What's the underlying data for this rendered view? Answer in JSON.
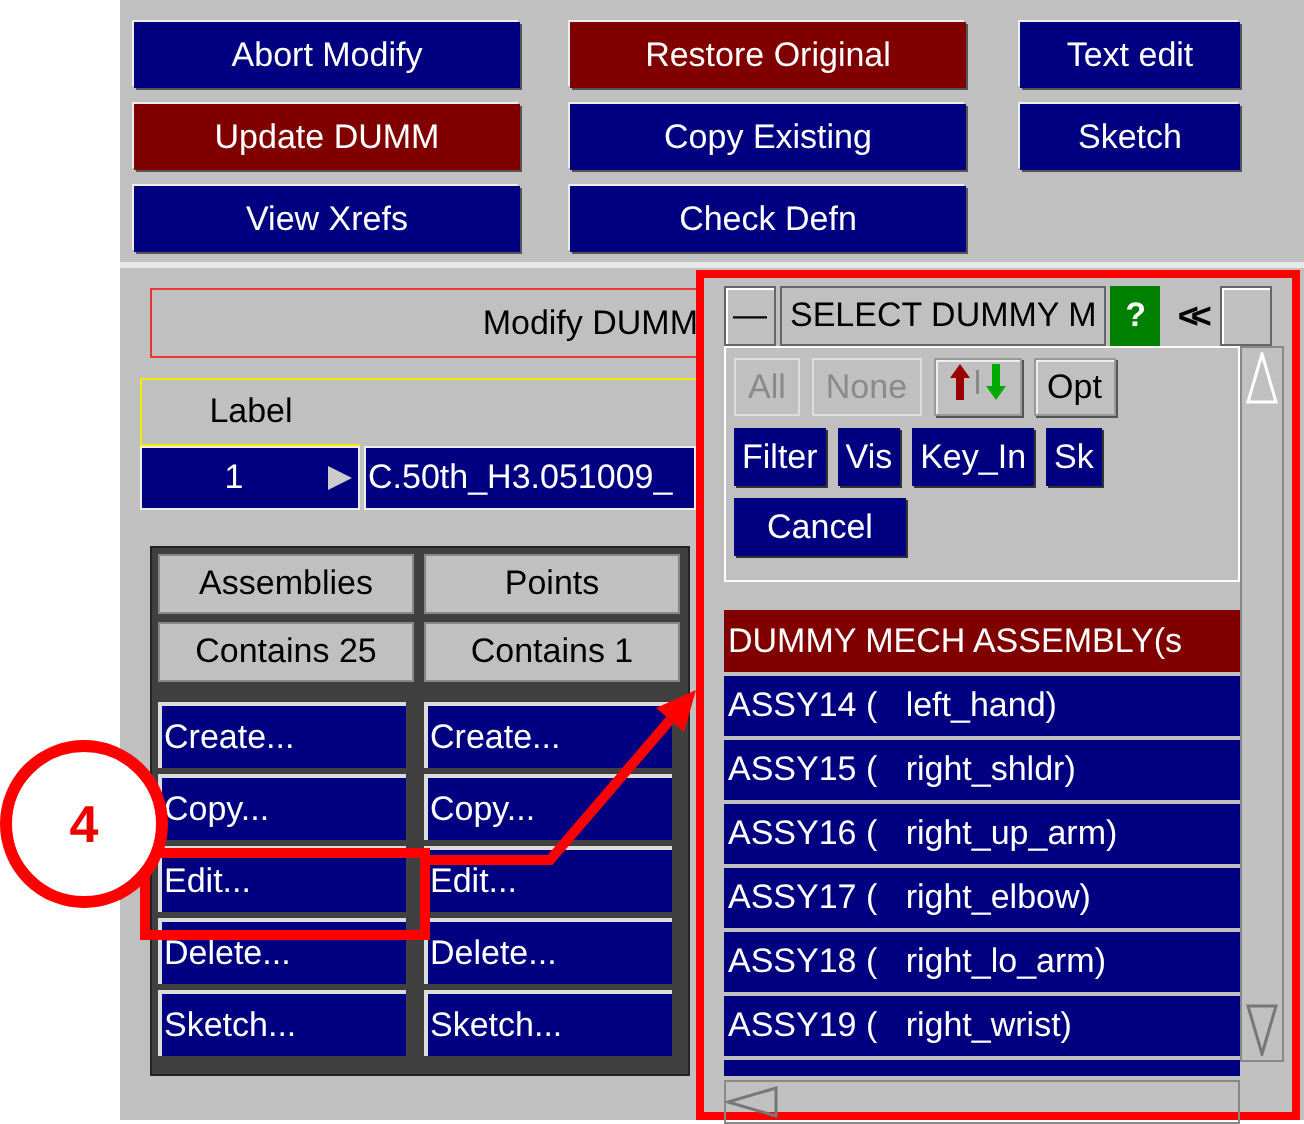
{
  "top_buttons": [
    [
      {
        "label": "Abort Modify",
        "color": "#000080"
      },
      {
        "label": "Update DUMM",
        "color": "#800000"
      },
      {
        "label": "View Xrefs",
        "color": "#000080"
      }
    ],
    [
      {
        "label": "Restore Original",
        "color": "#800000"
      },
      {
        "label": "Copy Existing",
        "color": "#000080"
      },
      {
        "label": "Check Defn",
        "color": "#000080"
      }
    ],
    [
      {
        "label": "Text edit",
        "color": "#000080"
      },
      {
        "label": "Sketch",
        "color": "#000080"
      }
    ]
  ],
  "form": {
    "title": "Modify DUMM",
    "label_header": "Label",
    "label_value": "1",
    "name_value": "C.50th_H3.051009_"
  },
  "tables": [
    {
      "header": "Assemblies",
      "count": "Contains 25",
      "actions": [
        "Create...",
        "Copy...",
        "Edit...",
        "Delete...",
        "Sketch..."
      ]
    },
    {
      "header": "Points",
      "count": "Contains 1",
      "actions": [
        "Create...",
        "Copy...",
        "Edit...",
        "Delete...",
        "Sketch..."
      ]
    }
  ],
  "popup": {
    "minimize": "—",
    "title": "SELECT DUMMY M",
    "help": "?",
    "collapse": "<<",
    "tool_buttons": [
      {
        "kind": "text",
        "label": "All",
        "disabled": true
      },
      {
        "kind": "text",
        "label": "None",
        "disabled": true
      },
      {
        "kind": "sort"
      },
      {
        "kind": "text",
        "label": "Opt",
        "disabled": false
      }
    ],
    "filter_buttons": [
      "Filter",
      "Vis",
      "Key_In",
      "Sk"
    ],
    "cancel": "Cancel",
    "list_header": "DUMMY MECH ASSEMBLY(s",
    "items": [
      {
        "id": "ASSY14 (",
        "name": "left_hand)"
      },
      {
        "id": "ASSY15 (",
        "name": "right_shldr)"
      },
      {
        "id": "ASSY16 (",
        "name": "right_up_arm)"
      },
      {
        "id": "ASSY17 (",
        "name": "right_elbow)"
      },
      {
        "id": "ASSY18 (",
        "name": "right_lo_arm)"
      },
      {
        "id": "ASSY19 (",
        "name": "right_wrist)"
      }
    ]
  },
  "annotation": {
    "step": "4"
  }
}
